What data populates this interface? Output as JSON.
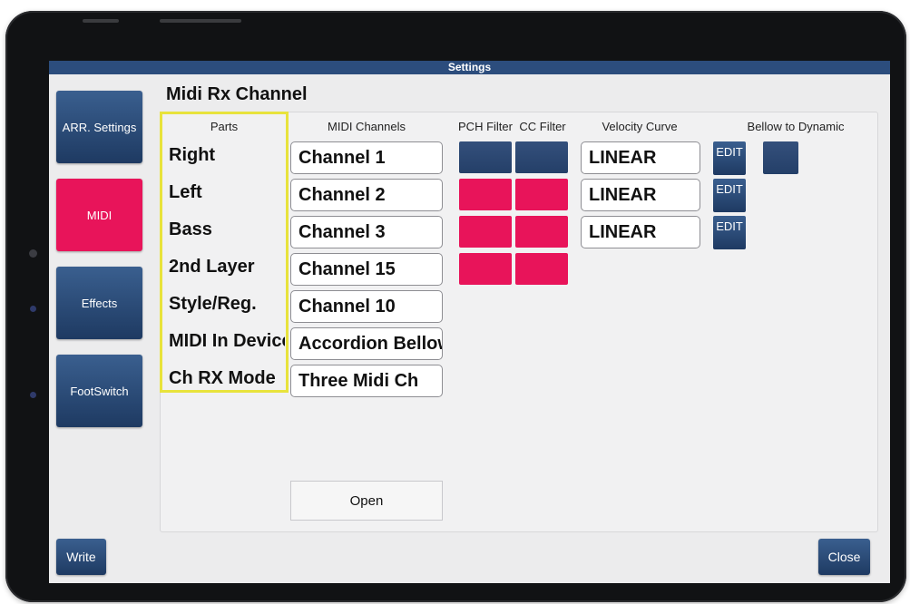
{
  "window": {
    "title": "Settings"
  },
  "sidebar": {
    "items": [
      {
        "label": "ARR. Settings",
        "active": false
      },
      {
        "label": "MIDI",
        "active": true
      },
      {
        "label": "Effects",
        "active": false
      },
      {
        "label": "FootSwitch",
        "active": false
      }
    ]
  },
  "page": {
    "heading": "Midi Rx Channel"
  },
  "columns": {
    "parts": "Parts",
    "midi_channels": "MIDI Channels",
    "pch_filter": "PCH Filter",
    "cc_filter": "CC Filter",
    "velocity_curve": "Velocity Curve",
    "bellow_to_dynamic": "Bellow to Dynamic"
  },
  "rows": [
    {
      "part": "Right",
      "channel": "Channel 1",
      "pch_on": false,
      "cc_on": false,
      "velocity": "LINEAR",
      "edit": "EDIT",
      "bellow": "off"
    },
    {
      "part": "Left",
      "channel": "Channel 2",
      "pch_on": true,
      "cc_on": true,
      "velocity": "LINEAR",
      "edit": "EDIT"
    },
    {
      "part": "Bass",
      "channel": "Channel 3",
      "pch_on": true,
      "cc_on": true,
      "velocity": "LINEAR",
      "edit": "EDIT"
    },
    {
      "part": "2nd Layer",
      "channel": "Channel 15",
      "pch_on": true,
      "cc_on": true
    },
    {
      "part": "Style/Reg.",
      "channel": "Channel 10"
    },
    {
      "part": "MIDI In Device",
      "channel": "Accordion Bellow"
    },
    {
      "part": "Ch RX Mode",
      "channel": "Three Midi Ch"
    }
  ],
  "buttons": {
    "open": "Open",
    "write": "Write",
    "close": "Close"
  },
  "colors": {
    "accent": "#e8145a",
    "primary": "#2c4d7d",
    "highlight": "#e8e33c"
  }
}
